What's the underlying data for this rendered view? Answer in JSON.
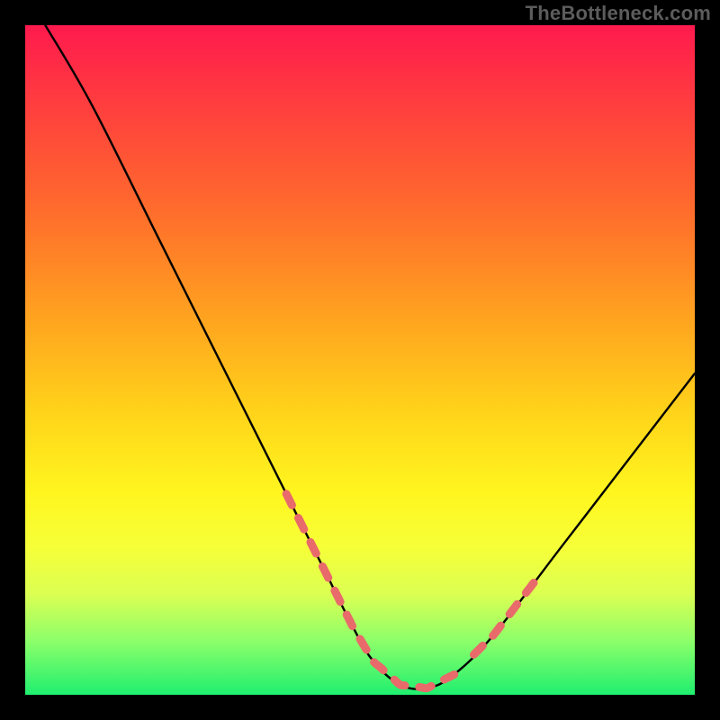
{
  "watermark": "TheBottleneck.com",
  "colors": {
    "background": "#000000",
    "curve_stroke": "#000000",
    "dash_stroke": "#e96a6a",
    "gradient": [
      "#ff1a4e",
      "#ff3e3e",
      "#ff6d2c",
      "#ffa41f",
      "#ffd41a",
      "#fff61f",
      "#f6ff38",
      "#dbff52",
      "#8cff6a",
      "#1fef6f"
    ]
  },
  "chart_data": {
    "type": "line",
    "title": "",
    "xlabel": "",
    "ylabel": "",
    "xlim": [
      0,
      100
    ],
    "ylim": [
      0,
      100
    ],
    "curve": {
      "x": [
        3,
        10,
        20,
        30,
        40,
        45,
        49,
        52,
        56,
        60,
        64,
        70,
        80,
        90,
        100
      ],
      "y": [
        100,
        88,
        68,
        48,
        28,
        18,
        10,
        5,
        1.5,
        1,
        3,
        9,
        22,
        35,
        48
      ]
    },
    "highlight_segments": [
      {
        "x_range": [
          39,
          49
        ],
        "style": "dashed"
      },
      {
        "x_range": [
          50,
          64
        ],
        "style": "dashed"
      },
      {
        "x_range": [
          67,
          76
        ],
        "style": "dashed"
      }
    ],
    "annotations": []
  }
}
